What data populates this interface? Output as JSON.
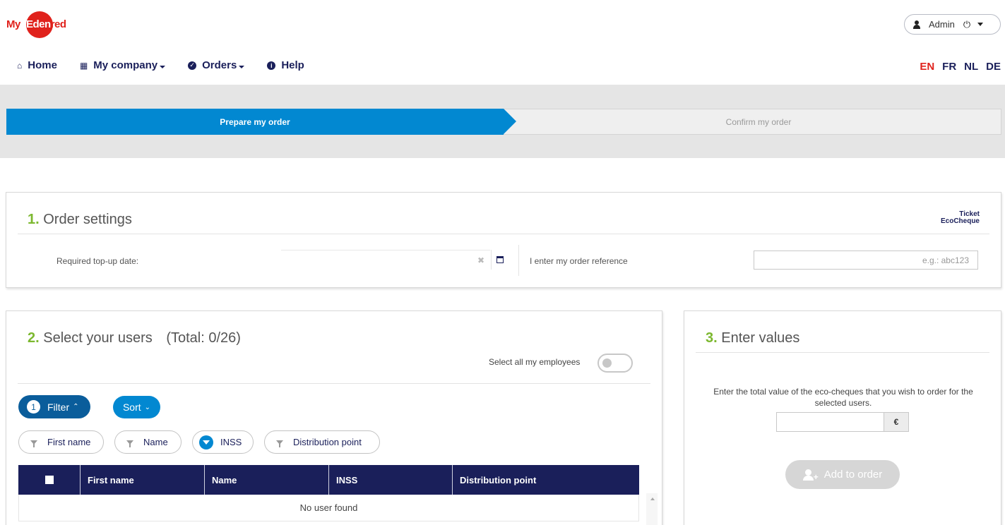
{
  "header": {
    "logo_my": "My",
    "logo_edenred": "Eden",
    "logo_tail": "red",
    "user": {
      "name": "Admin",
      "icon": "user-icon",
      "power_icon": "power-icon"
    },
    "nav": [
      {
        "label": "Home",
        "icon": "home-icon"
      },
      {
        "label": "My company",
        "icon": "building-icon",
        "dropdown": true
      },
      {
        "label": "Orders",
        "icon": "check-circle-icon",
        "dropdown": true
      },
      {
        "label": "Help",
        "icon": "info-icon"
      }
    ],
    "languages": [
      {
        "code": "EN",
        "active": true
      },
      {
        "code": "FR",
        "active": false
      },
      {
        "code": "NL",
        "active": false
      },
      {
        "code": "DE",
        "active": false
      }
    ]
  },
  "steps": {
    "step1": "Prepare my order",
    "step2": "Confirm my order"
  },
  "order_settings": {
    "num": "1.",
    "title": "Order settings",
    "brand_line1": "Ticket",
    "brand_line2": "EcoCheque",
    "date_label": "Required top-up date:",
    "date_value": "",
    "ref_label": "I enter my order reference",
    "ref_placeholder": "e.g.: abc123"
  },
  "users": {
    "num": "2.",
    "title": "Select your users",
    "total": "(Total: 0/26)",
    "select_all_label": "Select all my employees",
    "select_all_on": false,
    "filter_label": "Filter",
    "filter_count": "1",
    "sort_label": "Sort",
    "chips": [
      "First name",
      "Name",
      "INSS",
      "Distribution point"
    ],
    "columns": [
      "First name",
      "Name",
      "INSS",
      "Distribution point"
    ],
    "empty_text": "No user found"
  },
  "values": {
    "num": "3.",
    "title": "Enter values",
    "description": "Enter the total value of the eco-cheques that you wish to order for the selected users.",
    "currency": "€",
    "amount": "",
    "add_label": "Add to order"
  },
  "colors": {
    "brand_red": "#e0221c",
    "navy": "#1a1f5a",
    "step_blue": "#0288d1",
    "filter_blue": "#0a5d9b",
    "number_green": "#7cb82f"
  }
}
